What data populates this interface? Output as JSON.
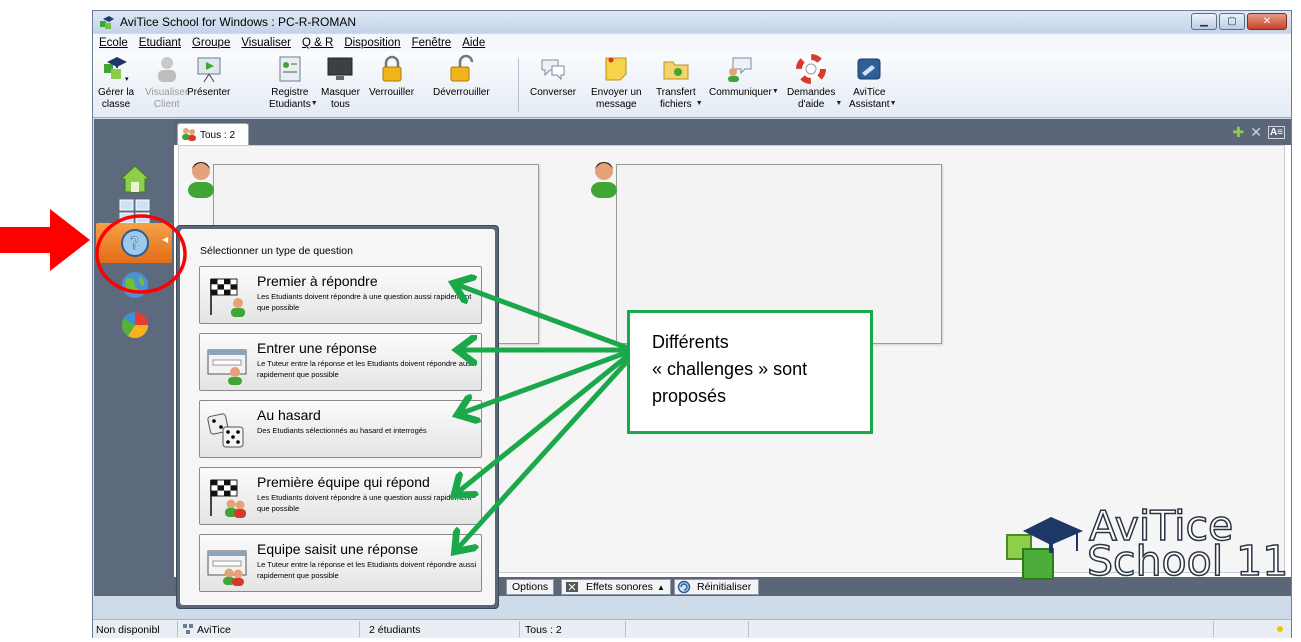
{
  "window": {
    "title": "AviTice School for Windows : PC-R-ROMAN",
    "buttons": [
      "minimize",
      "maximize",
      "close"
    ]
  },
  "menu": [
    "Ecole",
    "Etudiant",
    "Groupe",
    "Visualiser",
    "Q & R",
    "Disposition",
    "Fenêtre",
    "Aide"
  ],
  "toolbar": {
    "gerer": "Gérer la\nclasse",
    "visualiser": "Visualiser\nClient",
    "presenter": "Présenter",
    "registre": "Registre\nEtudiants",
    "masquer": "Masquer\ntous",
    "verrouiller": "Verrouiller",
    "deverrouiller": "Déverrouiller",
    "converser": "Converser",
    "envoyer": "Envoyer un\nmessage",
    "transfert": "Transfert\nfichiers",
    "communiquer": "Communiquer",
    "demandes": "Demandes\nd'aide",
    "assistant": "AviTice\nAssistant"
  },
  "tab": {
    "label": "Tous : 2"
  },
  "popup": {
    "title": "Sélectionner un type de question",
    "items": [
      {
        "title": "Premier à répondre",
        "desc": "Les Etudiants doivent répondre à une question aussi rapidement que possible",
        "icon": "checkered-flag-student-icon"
      },
      {
        "title": "Entrer une réponse",
        "desc": "Le Tuteur entre la réponse et les Etudiants doivent répondre aussi rapidement que possible",
        "icon": "answer-window-student-icon"
      },
      {
        "title": "Au hasard",
        "desc": "Des Etudiants sélectionnés au hasard et interrogés",
        "icon": "dice-icon"
      },
      {
        "title": "Première équipe qui répond",
        "desc": "Les Etudiants doivent répondre à une question aussi rapidement que possible",
        "icon": "checkered-flag-team-icon"
      },
      {
        "title": "Equipe saisit une réponse",
        "desc": "Le Tuteur entre la réponse et les Etudiants doivent répondre aussi rapidement que possible",
        "icon": "answer-window-team-icon"
      }
    ]
  },
  "bottombar": {
    "options": "Options",
    "effets": "Effets sonores",
    "reinit": "Réinitialiser"
  },
  "statusbar": {
    "status": "Non disponibl",
    "network": "AviTice",
    "students": "2 étudiants",
    "group": "Tous : 2"
  },
  "annotation": {
    "callout_lines": [
      "Différents",
      "« challenges » sont",
      "proposés"
    ],
    "arrow_color": "#1aa84a",
    "red_arrow_color": "#ff0000"
  },
  "logo": {
    "line1": "AviTice",
    "line2": "School 11"
  }
}
